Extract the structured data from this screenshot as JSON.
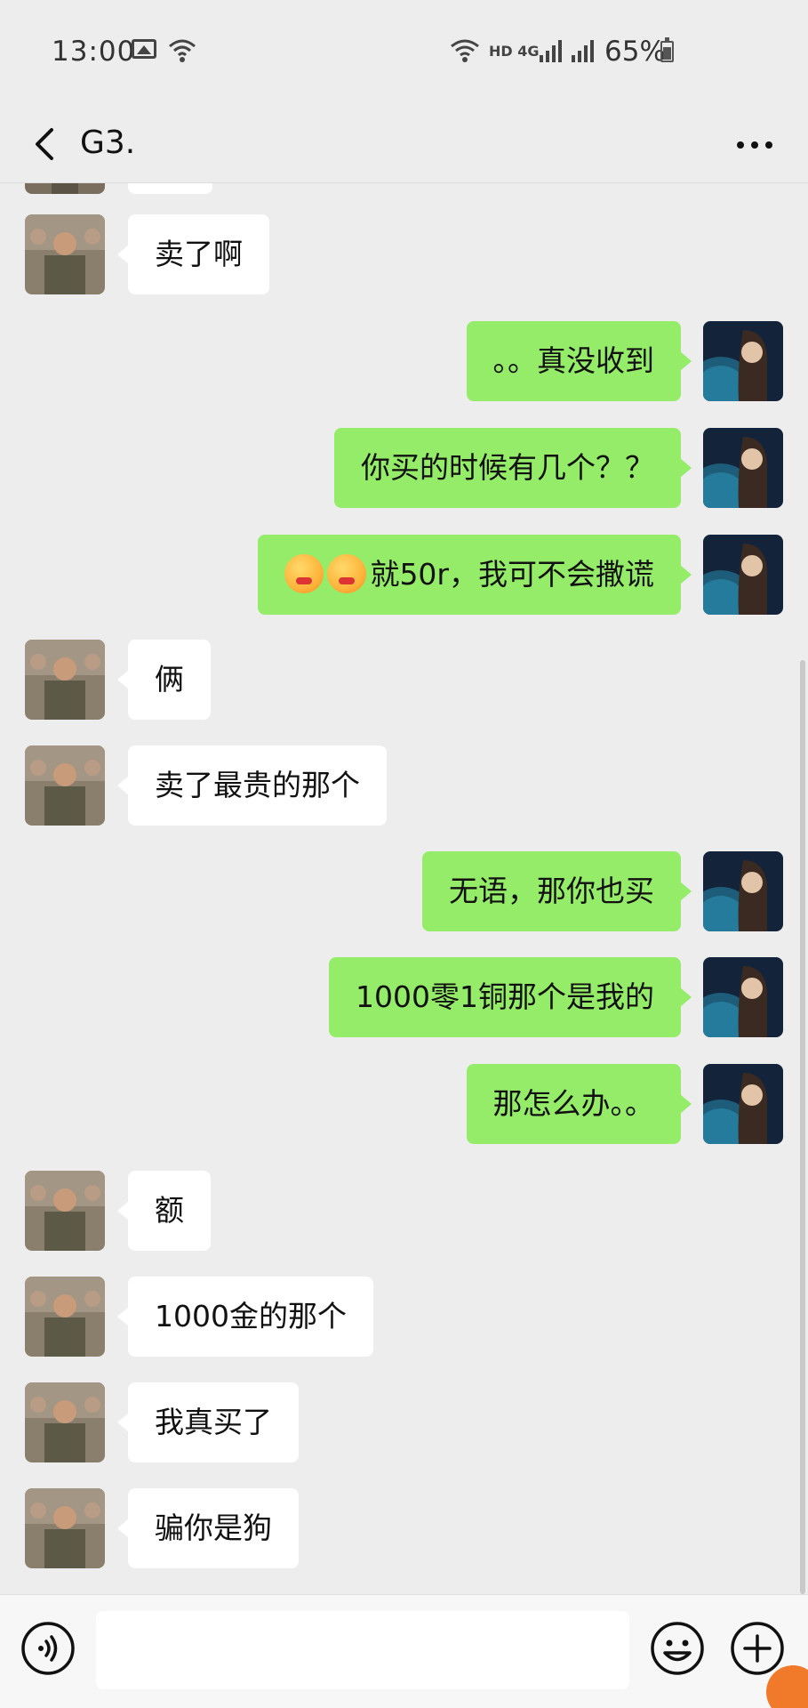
{
  "status_bar": {
    "time": "13:00",
    "network": "HD 4G",
    "battery": "65%",
    "icons": [
      "image-icon",
      "wifi-icon",
      "signal-icon",
      "battery-icon"
    ]
  },
  "header": {
    "title": "G3.",
    "back_icon": "chevron-left-icon",
    "more_icon": "more-dots-icon"
  },
  "messages": [
    {
      "side": "left",
      "text": "卖了啊"
    },
    {
      "side": "right",
      "text": "。。真没收到"
    },
    {
      "side": "right",
      "text": "你买的时候有几个？？"
    },
    {
      "side": "right",
      "text": "就50r，我可不会撒谎",
      "emoji_prefix_count": 2
    },
    {
      "side": "left",
      "text": "俩"
    },
    {
      "side": "left",
      "text": "卖了最贵的那个"
    },
    {
      "side": "right",
      "text": "无语，那你也买"
    },
    {
      "side": "right",
      "text": "1000零1铜那个是我的"
    },
    {
      "side": "right",
      "text": "那怎么办。。"
    },
    {
      "side": "left",
      "text": "额"
    },
    {
      "side": "left",
      "text": "1000金的那个"
    },
    {
      "side": "left",
      "text": "我真买了"
    },
    {
      "side": "left",
      "text": "骗你是狗"
    }
  ],
  "input_bar": {
    "voice_icon": "voice-icon",
    "input_value": "",
    "emoji_icon": "emoji-icon",
    "plus_icon": "plus-icon"
  },
  "colors": {
    "background": "#ededed",
    "sent_bubble": "#95ec69",
    "received_bubble": "#ffffff"
  }
}
